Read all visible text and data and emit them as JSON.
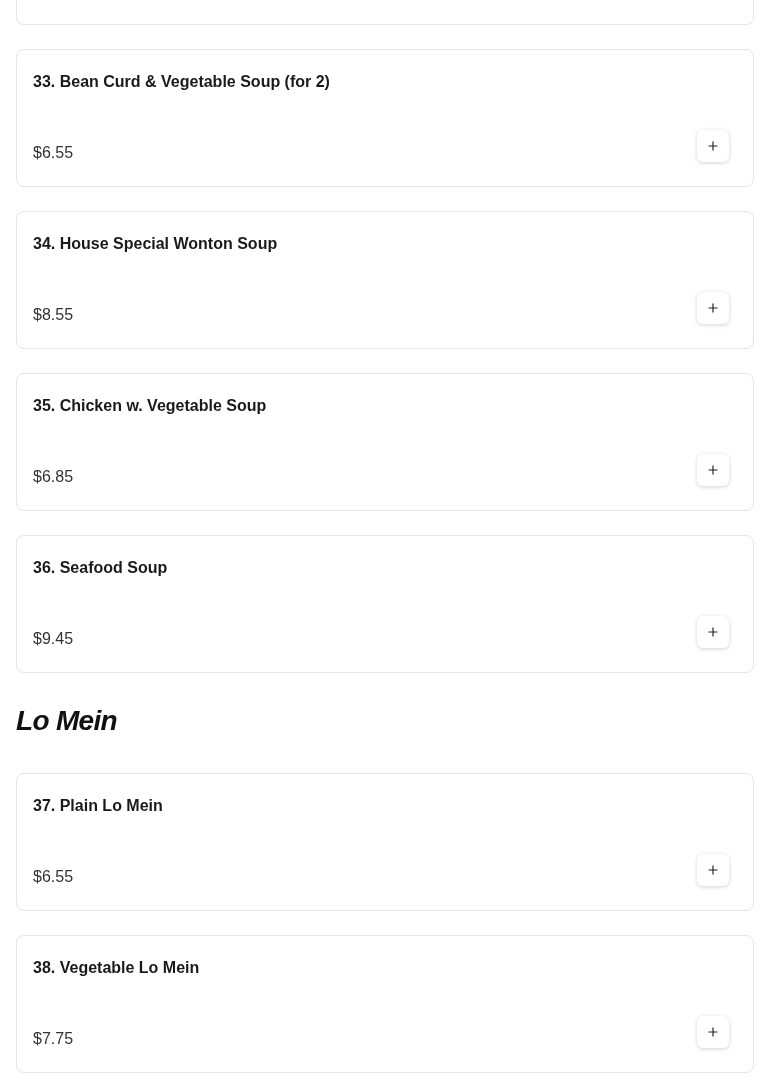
{
  "sections": [
    {
      "items": [
        {
          "name": "33. Bean Curd & Vegetable Soup (for 2)",
          "price": "$6.55"
        },
        {
          "name": "34. House Special Wonton Soup",
          "price": "$8.55"
        },
        {
          "name": "35. Chicken w. Vegetable Soup",
          "price": "$6.85"
        },
        {
          "name": "36. Seafood Soup",
          "price": "$9.45"
        }
      ]
    },
    {
      "title": "Lo Mein",
      "items": [
        {
          "name": "37. Plain Lo Mein",
          "price": "$6.55"
        },
        {
          "name": "38. Vegetable Lo Mein",
          "price": "$7.75"
        }
      ]
    }
  ]
}
